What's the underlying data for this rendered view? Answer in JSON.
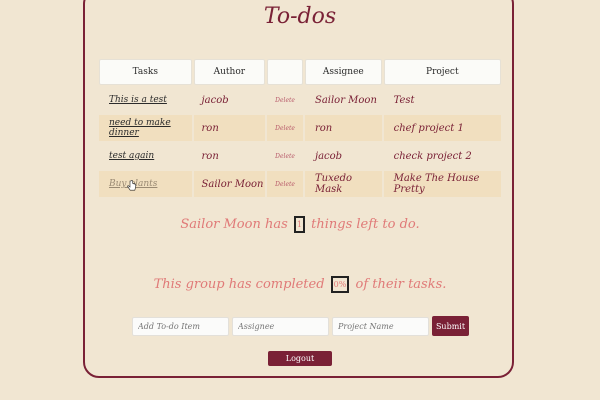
{
  "app": {
    "title": "To-dos"
  },
  "table": {
    "headers": [
      "Tasks",
      "Author",
      "",
      "Assignee",
      "Project"
    ],
    "rows": [
      {
        "task": "This is a test",
        "author": "jacob",
        "delete_label": "Delete",
        "assignee": "Sailor Moon",
        "project": "Test"
      },
      {
        "task": "need to make dinner",
        "author": "ron",
        "delete_label": "Delete",
        "assignee": "ron",
        "project": "chef project 1"
      },
      {
        "task": "test again",
        "author": "ron",
        "delete_label": "Delete",
        "assignee": "jacob",
        "project": "check project 2"
      },
      {
        "task": "Buy plants",
        "author": "Sailor Moon",
        "delete_label": "Delete",
        "assignee": "Tuxedo Mask",
        "project": "Make The House Pretty"
      }
    ]
  },
  "summary": {
    "user_name": "Sailor Moon",
    "has_text": "has",
    "count": "1",
    "things_text": "things left to do."
  },
  "group": {
    "prefix": "This group has completed",
    "percent": "0%",
    "suffix": "of their tasks."
  },
  "form": {
    "todo_placeholder": "Add To-do Item",
    "assignee_placeholder": "Assignee",
    "project_placeholder": "Project Name",
    "submit_label": "Submit"
  },
  "logout_label": "Logout",
  "colors": {
    "accent": "#7a2136",
    "background": "#f1e6d2",
    "band": "#f1dfbf",
    "message": "#e07a78"
  }
}
